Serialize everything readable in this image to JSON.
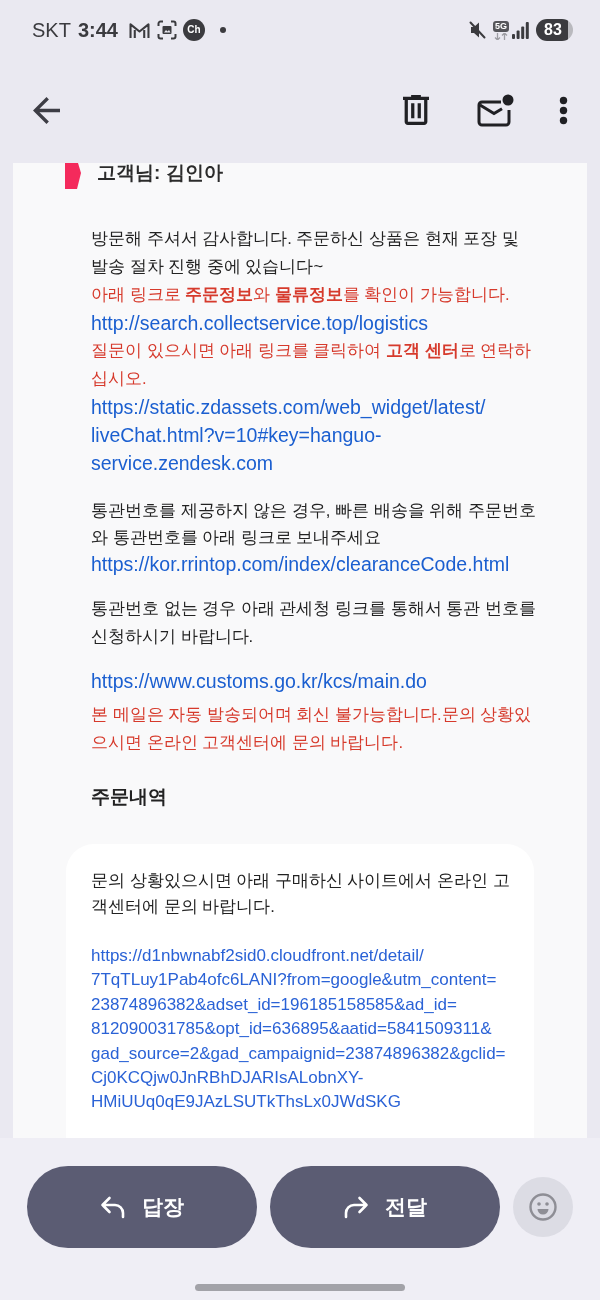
{
  "status_bar": {
    "carrier": "SKT",
    "time": "3:44",
    "chat_badge": "Ch",
    "network": "5G",
    "battery": "83"
  },
  "email": {
    "recipient_heading": "고객님: 김인아",
    "blocks": [
      {
        "lines": [
          {
            "kind": "text",
            "text": "방문해 주셔서 감사합니다. 주문하신 상품은 현재 포장 및 발송 절차 진행 중에 있습니다~"
          },
          {
            "kind": "notice",
            "text": "아래 링크로 **주문정보**와 **물류정보**를 확인이 가능합니다."
          },
          {
            "kind": "link",
            "text": "http://search.collectservice.top/logistics"
          },
          {
            "kind": "notice",
            "text": "질문이 있으시면 아래 링크를 클릭하여 **고객 센터**로 연락하십시오."
          },
          {
            "kind": "link",
            "text": "https://static.zdassets.com/web_widget/latest/liveChat.html?v=10#key=hanguo-service.zendesk.com"
          }
        ]
      },
      {
        "lines": [
          {
            "kind": "text",
            "text": "통관번호를 제공하지 않은 경우, 빠른 배송을 위해 주문번호와 통관번호를 아래 링크로 보내주세요"
          },
          {
            "kind": "link",
            "text": "https://kor.rrintop.com/index/clearanceCode.html"
          }
        ]
      },
      {
        "lines": [
          {
            "kind": "text",
            "text": "통관번호 없는 경우 아래 관세청 링크를 통해서 통관 번호를 신청하시기 바랍니다."
          }
        ]
      },
      {
        "lines": [
          {
            "kind": "link",
            "text": "https://www.customs.go.kr/kcs/main.do"
          }
        ]
      },
      {
        "lines": [
          {
            "kind": "notice",
            "text": "본 메일은 자동 발송되어며 회신 불가능합니다.문의 상황있으시면 온라인 고객센터에 문의 바랍니다."
          }
        ]
      }
    ],
    "section_heading": "주문내역",
    "order_card": {
      "message": "문의 상황있으시면 아래 구매하신 사이트에서 온라인 고객센터에 문의 바랍니다.",
      "link": "https://d1nbwnabf2sid0.cloudfront.net/detail/7TqTLuy1Pab4ofc6LANI?from=google&utm_content=23874896382&adset_id=196185158585&ad_id=812090031785&opt_id=636895&aatid=5841509311&gad_source=2&gad_campaignid=23874896382&gclid=Cj0KCQjw0JnRBhDJARIsALobnXY-HMiUUq0qE9JAzLSUTkThsLx0JWdSKG"
    }
  },
  "actions": {
    "reply": "답장",
    "forward": "전달"
  }
}
